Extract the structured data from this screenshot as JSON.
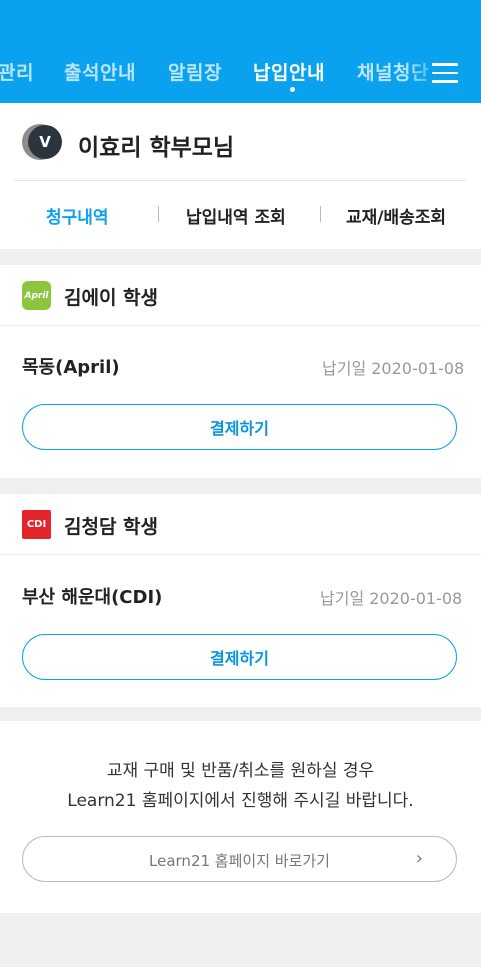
{
  "colors": {
    "accent": "#0aa2ee",
    "april_green": "#8cc63f",
    "cdi_red": "#e3262c"
  },
  "top_nav": {
    "items": [
      "관리",
      "출석안내",
      "알림장",
      "납입안내",
      "채널청단"
    ],
    "active_index": 3,
    "menu_icon": "hamburger-menu-icon"
  },
  "parent": {
    "avatar_letter": "V",
    "name": "이효리 학부모님"
  },
  "sub_tabs": [
    "청구내역",
    "납입내역 조회",
    "교재/배송조회"
  ],
  "students": [
    {
      "badge_text": "April",
      "name": "김에이 학생",
      "branch": "목동(April)",
      "due_label": "납기일 2020-01-08",
      "pay_label": "결제하기"
    },
    {
      "badge_text": "CDI",
      "name": "김청담 학생",
      "branch": "부산 해운대(CDI)",
      "due_label": "납기일 2020-01-08",
      "pay_label": "결제하기"
    }
  ],
  "notice": {
    "line1": "교재 구매 및 반품/취소를 원하실 경우",
    "line2": "Learn21 홈페이지에서 진행해 주시길 바랍니다.",
    "link_label": "Learn21 홈페이지 바로가기",
    "link_icon": "chevron-right-icon"
  }
}
